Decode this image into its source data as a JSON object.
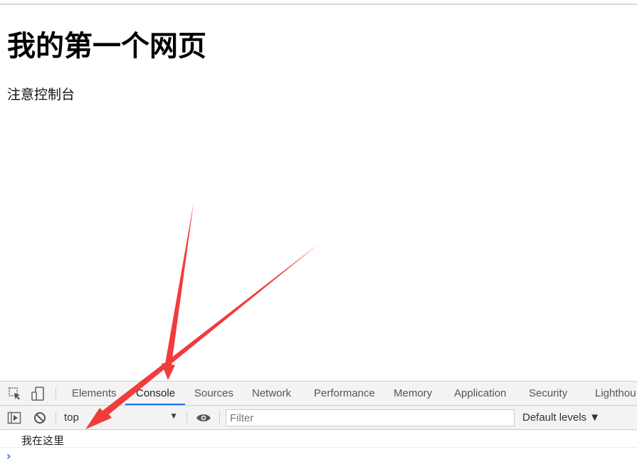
{
  "page": {
    "title": "我的第一个网页",
    "text": "注意控制台"
  },
  "devtools": {
    "tabs": [
      {
        "label": "Elements"
      },
      {
        "label": "Console",
        "active": true
      },
      {
        "label": "Sources"
      },
      {
        "label": "Network"
      },
      {
        "label": "Performance"
      },
      {
        "label": "Memory"
      },
      {
        "label": "Application"
      },
      {
        "label": "Security"
      },
      {
        "label": "Lighthou"
      }
    ],
    "toolbar": {
      "context": "top",
      "filter_placeholder": "Filter",
      "levels": "Default levels ▼"
    },
    "console": {
      "messages": [
        "我在这里"
      ],
      "prompt": "›"
    },
    "icons": [
      "inspect-icon",
      "device-toggle-icon",
      "sidebar-toggle-icon",
      "clear-console-icon",
      "eye-icon"
    ],
    "colors": {
      "accent": "#1a73e8",
      "annotation_arrow": "#f03c3c"
    }
  }
}
